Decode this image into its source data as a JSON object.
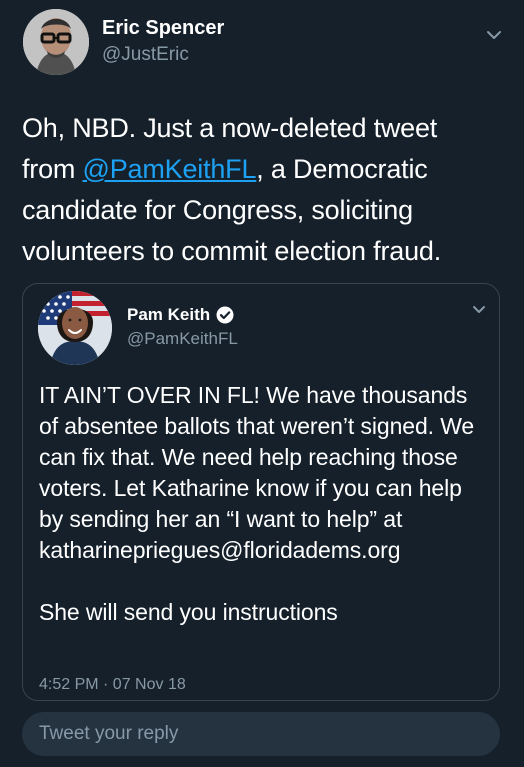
{
  "tweet": {
    "author_name": "Eric Spencer",
    "author_handle": "@JustEric",
    "text_before_mention": "Oh, NBD. Just a now-deleted tweet from ",
    "mention": "@PamKeithFL",
    "text_after_mention": ", a Democratic candidate for Congress, soliciting volunteers to commit election fraud.",
    "menu_icon": "chevron-down-icon"
  },
  "quoted_tweet": {
    "author_name": "Pam Keith",
    "author_handle": "@PamKeithFL",
    "verified_icon": "verified-badge-icon",
    "body": "IT AIN’T OVER IN FL! We have thousands of absentee ballots that weren’t signed. We can fix that. We need help reaching those voters. Let Katharine know if you can help by sending her an “I want to help” at katharinepriegues@floridadems.org\n\nShe will send you instructions",
    "timestamp": "4:52 PM · 07 Nov 18",
    "menu_icon": "chevron-down-icon"
  },
  "reply": {
    "placeholder": "Tweet your reply"
  },
  "colors": {
    "background": "#15202b",
    "link": "#1da1f2",
    "secondary_text": "#8899a6",
    "border": "#38444d",
    "reply_box": "#253341"
  }
}
